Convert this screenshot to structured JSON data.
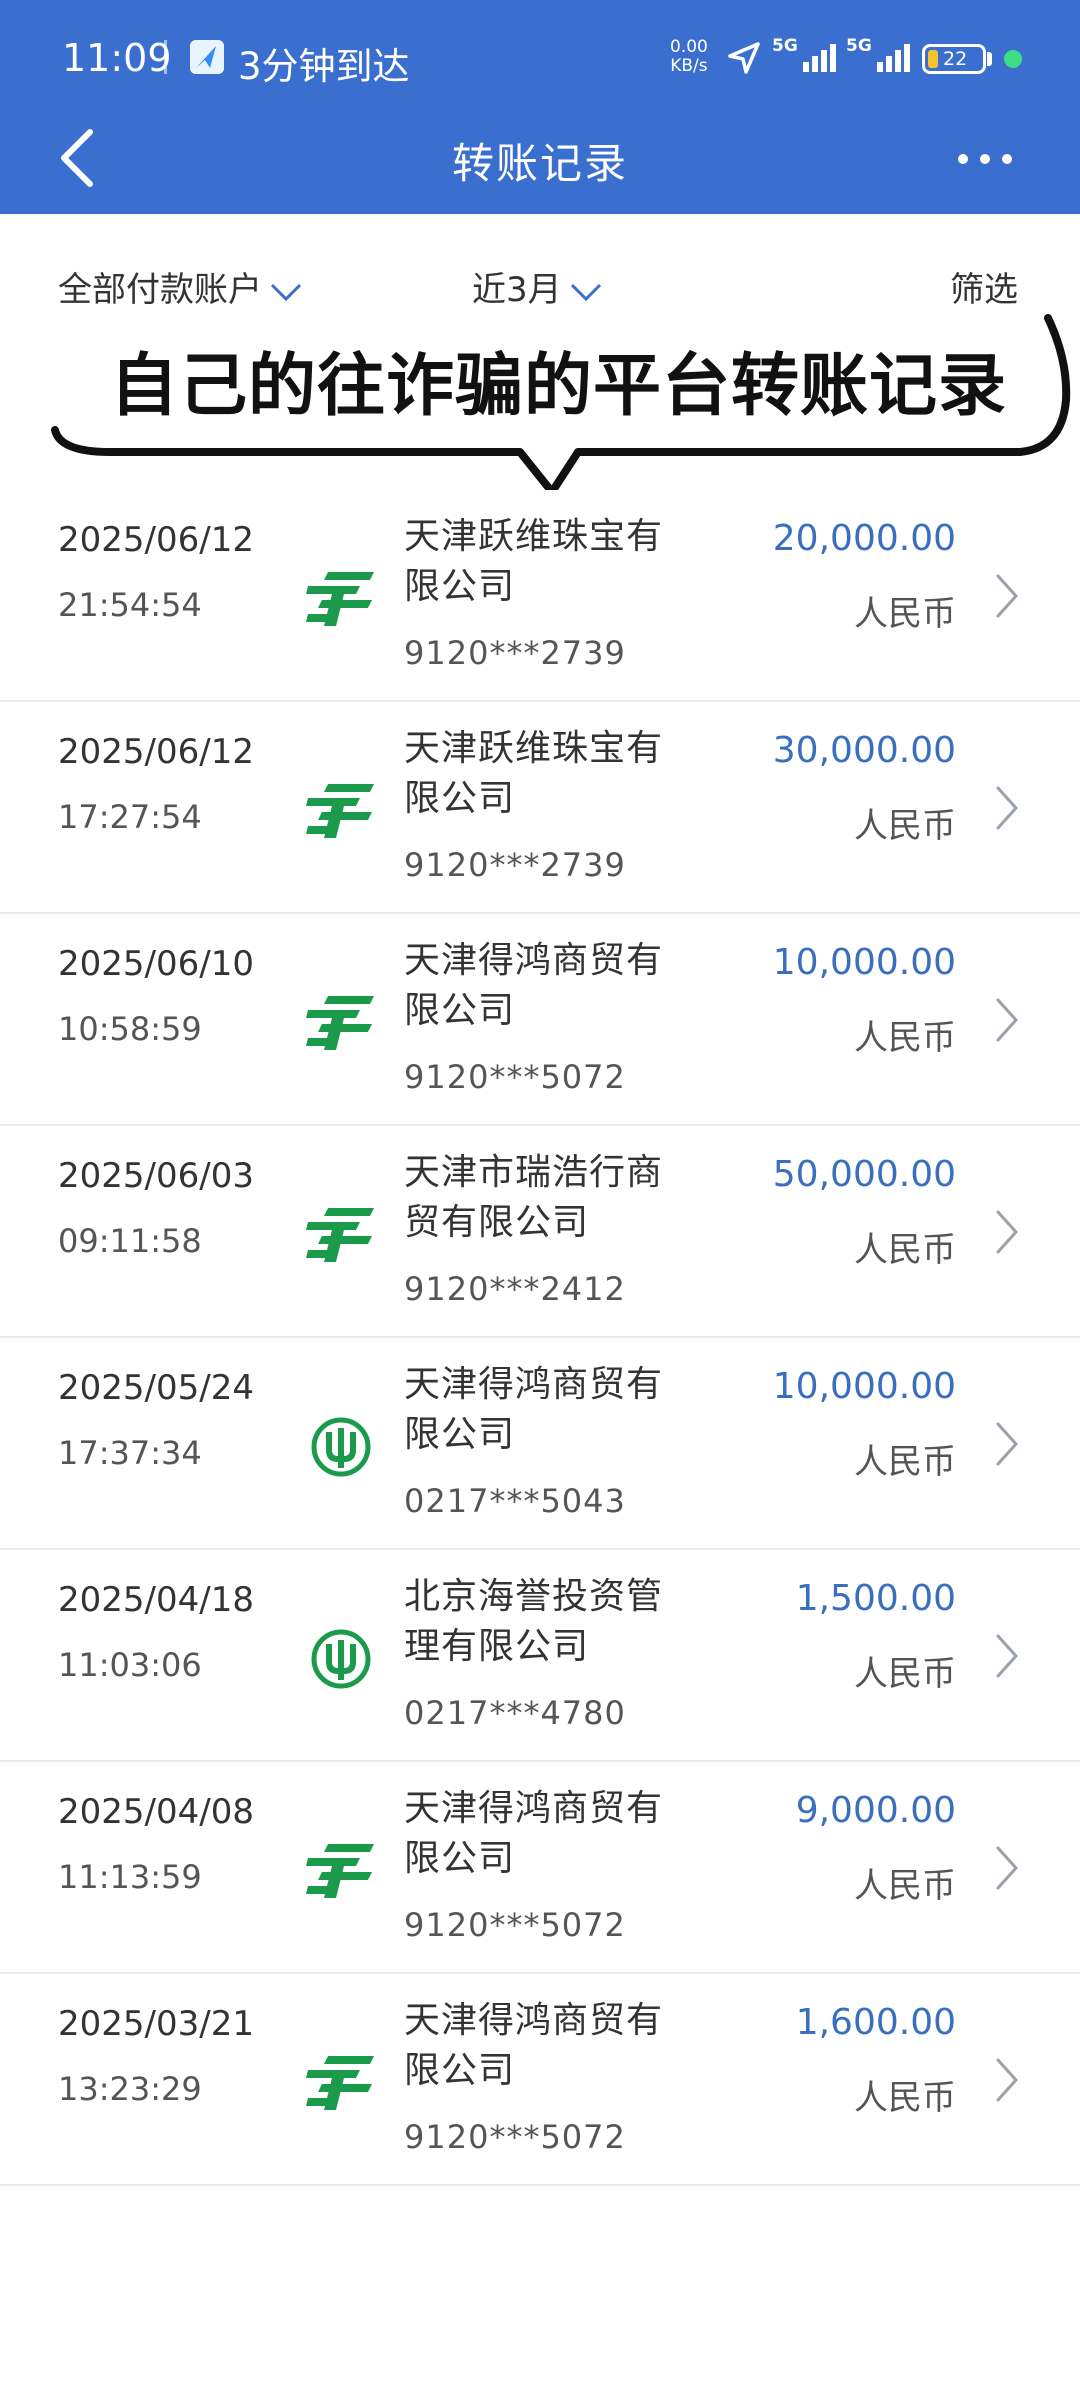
{
  "status_bar": {
    "time": "11:09",
    "navigation_eta": "3分钟到达",
    "net_speed_value": "0.00",
    "net_speed_unit": "KB/s",
    "signal1_label": "5G",
    "signal2_label": "5G",
    "battery_level": "22",
    "icons": [
      "navigation-app-icon",
      "location-arrow-icon",
      "signal-icon",
      "signal-icon",
      "battery-icon",
      "charging-dot-icon"
    ]
  },
  "header": {
    "title": "转账记录",
    "back_icon": "chevron-left-icon",
    "more_icon": "more-dots-icon"
  },
  "filters": {
    "account": "全部付款账户",
    "period": "近3月",
    "filter": "筛选"
  },
  "callout": {
    "text": "自己的往诈骗的平台转账记录"
  },
  "records": [
    {
      "date": "2025/06/12",
      "time": "21:54:54",
      "bank_icon": "postal-savings-bank-icon",
      "payee_line1": "天津跃维珠宝有",
      "payee_line2": "限公司",
      "account": "9120***2739",
      "amount": "20,000.00",
      "currency": "人民币"
    },
    {
      "date": "2025/06/12",
      "time": "17:27:54",
      "bank_icon": "postal-savings-bank-icon",
      "payee_line1": "天津跃维珠宝有",
      "payee_line2": "限公司",
      "account": "9120***2739",
      "amount": "30,000.00",
      "currency": "人民币"
    },
    {
      "date": "2025/06/10",
      "time": "10:58:59",
      "bank_icon": "postal-savings-bank-icon",
      "payee_line1": "天津得鸿商贸有",
      "payee_line2": "限公司",
      "account": "9120***5072",
      "amount": "10,000.00",
      "currency": "人民币"
    },
    {
      "date": "2025/06/03",
      "time": "09:11:58",
      "bank_icon": "postal-savings-bank-icon",
      "payee_line1": "天津市瑞浩行商",
      "payee_line2": "贸有限公司",
      "account": "9120***2412",
      "amount": "50,000.00",
      "currency": "人民币"
    },
    {
      "date": "2025/05/24",
      "time": "17:37:34",
      "bank_icon": "agricultural-bank-icon",
      "payee_line1": "天津得鸿商贸有",
      "payee_line2": "限公司",
      "account": "0217***5043",
      "amount": "10,000.00",
      "currency": "人民币"
    },
    {
      "date": "2025/04/18",
      "time": "11:03:06",
      "bank_icon": "agricultural-bank-icon",
      "payee_line1": "北京海誉投资管",
      "payee_line2": "理有限公司",
      "account": "0217***4780",
      "amount": "1,500.00",
      "currency": "人民币"
    },
    {
      "date": "2025/04/08",
      "time": "11:13:59",
      "bank_icon": "postal-savings-bank-icon",
      "payee_line1": "天津得鸿商贸有",
      "payee_line2": "限公司",
      "account": "9120***5072",
      "amount": "9,000.00",
      "currency": "人民币"
    },
    {
      "date": "2025/03/21",
      "time": "13:23:29",
      "bank_icon": "postal-savings-bank-icon",
      "payee_line1": "天津得鸿商贸有",
      "payee_line2": "限公司",
      "account": "9120***5072",
      "amount": "1,600.00",
      "currency": "人民币"
    }
  ],
  "colors": {
    "header_bg": "#3a6fd0",
    "amount": "#3a6fbf",
    "postal_green": "#1a9a4a"
  }
}
